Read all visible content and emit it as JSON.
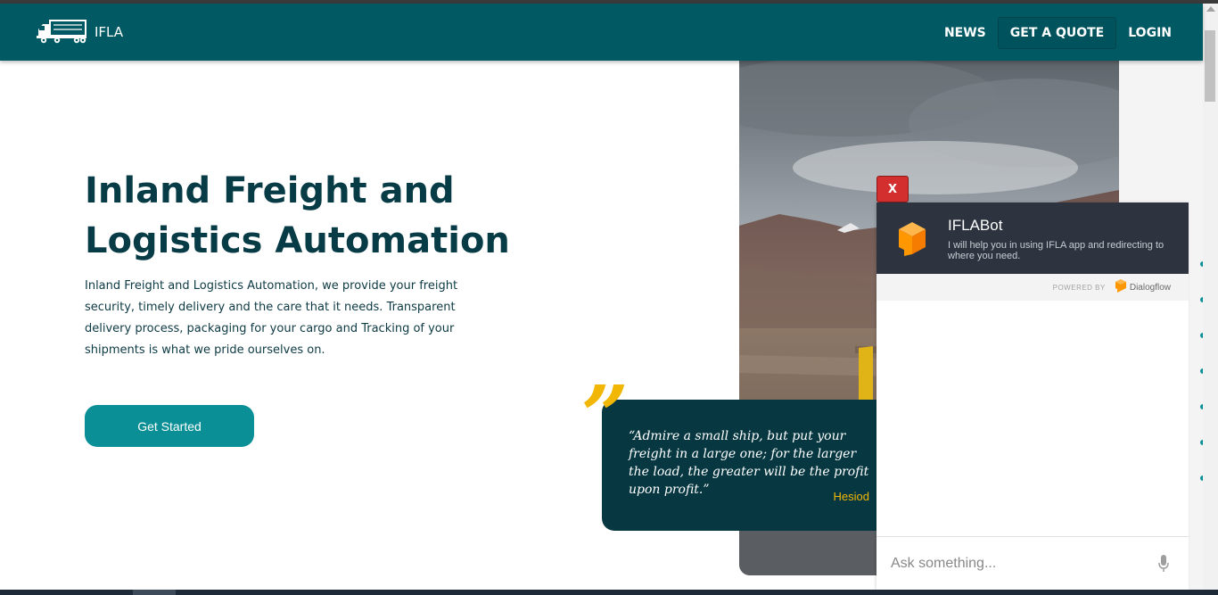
{
  "navbar": {
    "brand": "IFLA",
    "links": [
      "NEWS",
      "GET A QUOTE",
      "LOGIN"
    ]
  },
  "hero": {
    "title": "Inland Freight and Logistics Automation",
    "description": "Inland Freight and Logistics Automation, we provide your freight security, timely delivery and the care that it needs. Transparent delivery process, packaging for your cargo and Tracking of your shipments is what we pride ourselves on.",
    "cta_label": "Get Started"
  },
  "quote": {
    "mark": "”",
    "text": "“Admire a small ship, but put your freight in a large one; for the larger the load, the greater will be the profit upon profit.”",
    "author": "Hesiod"
  },
  "chatbot": {
    "close_label": "X",
    "title": "IFLABot",
    "subtitle": "I will help you in using IFLA app and redirecting to where you need.",
    "powered_by": "POWERED BY",
    "provider": "Dialogflow",
    "input_placeholder": "Ask something..."
  },
  "colors": {
    "navbar": "#005963",
    "heading": "#073b46",
    "button": "#0a8f96",
    "quote_card": "#073842",
    "accent": "#f2b705",
    "chat_header": "#2d3440",
    "close_button": "#d32f2f"
  },
  "icons": {
    "brand": "truck-icon",
    "bot": "dialogflow-cube-icon",
    "provider": "dialogflow-logo-icon",
    "mic": "microphone-icon"
  }
}
